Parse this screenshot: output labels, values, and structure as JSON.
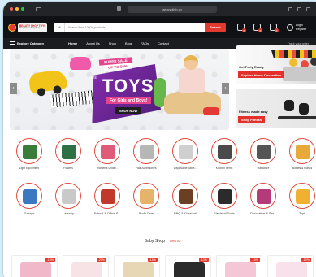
{
  "browser": {
    "url": "aerusplish.co",
    "dots": [
      "#ff5f57",
      "#febc2e",
      "#28c840"
    ]
  },
  "header": {
    "logo_line1": "BEAUTY SHOP TOYS",
    "logo_line2": "Party Fitness Baby Shop",
    "search_category": "All",
    "search_placeholder": "Search from 1000+ products...",
    "search_button": "Search",
    "wishlist_badge": "0",
    "compare_badge": "0",
    "cart_badge": "0",
    "login_line1": "Login",
    "login_line2": "Register"
  },
  "nav": {
    "explore": "Explore Category",
    "links": [
      "Home",
      "About Us",
      "Shop",
      "Blog",
      "FAQs",
      "Contact"
    ],
    "track": "Track your order"
  },
  "hero": {
    "sale_line1": "SUPER SALE",
    "sale_line2": "UP TO 50%",
    "best": "Best",
    "toys": "TOYS",
    "subtitle": "For Girls and Boys!",
    "shop_now": "SHOP NOW"
  },
  "side_banners": [
    {
      "title": "Get Party Ready",
      "button": "Explore Home Decoration"
    },
    {
      "title": "Fitness made easy",
      "button": "Shop Fitness"
    }
  ],
  "categories_row1": [
    {
      "label": "Light Equipment",
      "color": "#3a7d3a"
    },
    {
      "label": "Flowers",
      "color": "#2f6f44"
    },
    {
      "label": "Women's Under...",
      "color": "#e05a7a"
    },
    {
      "label": "Hair Accessories",
      "color": "#b7b7b7"
    },
    {
      "label": "Disposable Table...",
      "color": "#cfcfcf"
    },
    {
      "label": "Kitchen Items",
      "color": "#4a4a4a"
    },
    {
      "label": "Hardware",
      "color": "#555555"
    },
    {
      "label": "Bottles & Flasks",
      "color": "#e6a93a"
    }
  ],
  "categories_row2": [
    {
      "label": "Garage",
      "color": "#3b78c2"
    },
    {
      "label": "Laundry",
      "color": "#c9c9c9"
    },
    {
      "label": "School & Office S...",
      "color": "#c0392b"
    },
    {
      "label": "Body Care",
      "color": "#e6b36a"
    },
    {
      "label": "BBQ & Charcoal",
      "color": "#6b3f22"
    },
    {
      "label": "Electrical Tools",
      "color": "#2b2b2b"
    },
    {
      "label": "Decoration & Par...",
      "color": "#b53a7a"
    },
    {
      "label": "Toys",
      "color": "#f0b133"
    }
  ],
  "baby_shop": {
    "title": "Baby Shop",
    "view_all": "View All",
    "products": [
      {
        "discount": "-13%",
        "color": "#f1b8c9"
      },
      {
        "discount": "-20%",
        "color": "#f7e3e6"
      },
      {
        "discount": "-15%",
        "color": "#e8d7b5"
      },
      {
        "discount": "-10%",
        "color": "#2b2b2b"
      },
      {
        "discount": "-10%",
        "color": "#f5c6d6"
      },
      {
        "discount": "-10%",
        "color": "#f8e1ea"
      }
    ]
  }
}
